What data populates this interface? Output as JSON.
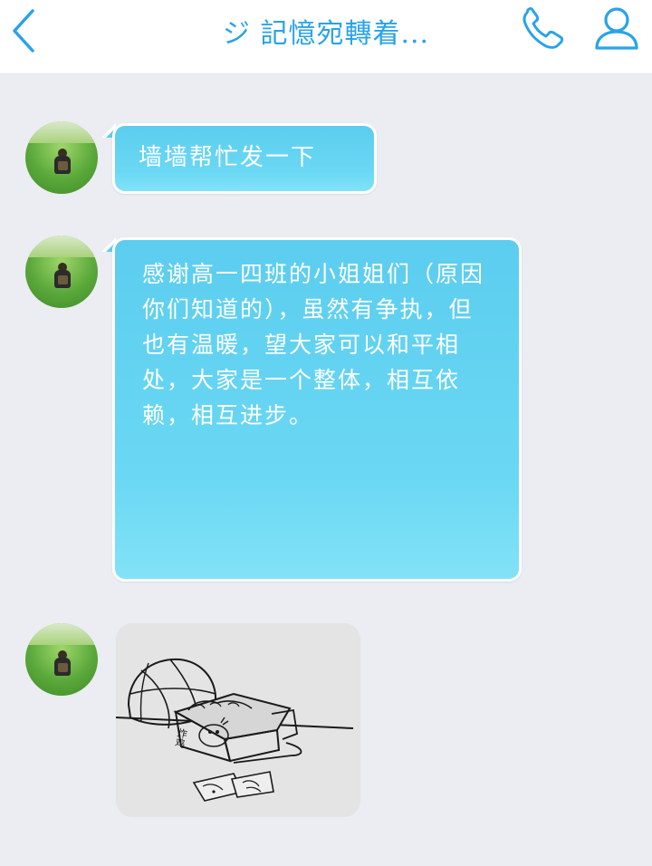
{
  "header": {
    "title": "ジ 記憶宛轉着...",
    "accent_color": "#29a3e8",
    "back_icon": "chevron-left-icon",
    "call_icon": "phone-icon",
    "profile_icon": "user-icon"
  },
  "messages": [
    {
      "type": "text",
      "text": "墙墙帮忙发一下"
    },
    {
      "type": "text",
      "text": "感谢高一四班的小姐姐们（原因你们知道的），虽然有争执，但也有温暖，望大家可以和平相处，大家是一个整体，相互依赖，相互进步。"
    },
    {
      "type": "image",
      "content": "hand-drawn sketch: basketball and fried-chicken box",
      "box_label": "炸鸡"
    }
  ],
  "colors": {
    "bubble": "#5ccdef",
    "background": "#ebedf2"
  }
}
